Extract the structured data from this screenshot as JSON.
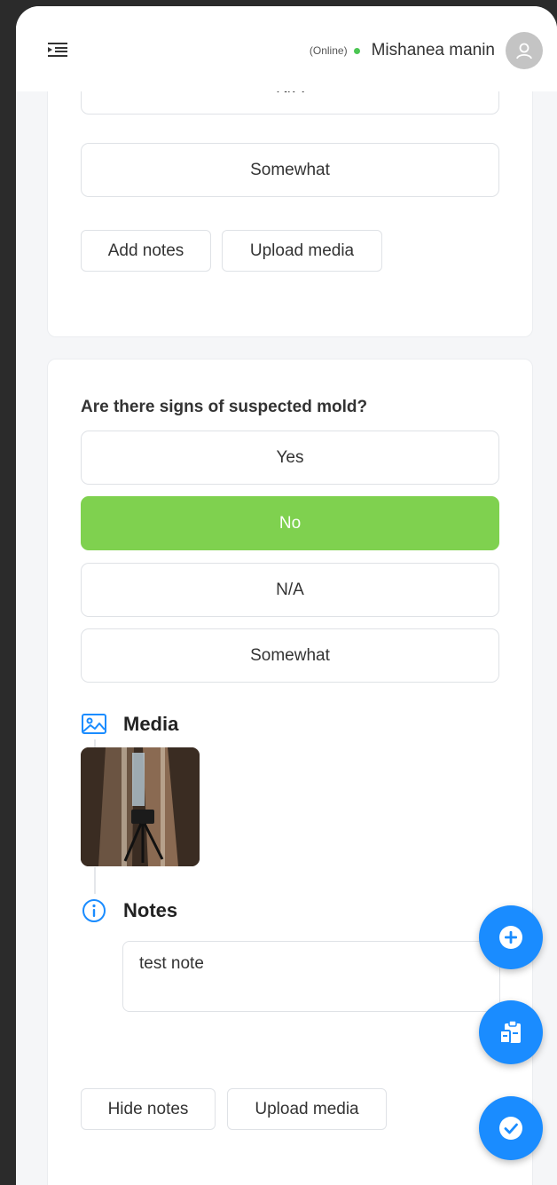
{
  "header": {
    "status": "(Online)",
    "user_name": "Mishanea manin"
  },
  "card1": {
    "options": [
      "N/A",
      "Somewhat"
    ],
    "add_notes_label": "Add notes",
    "upload_media_label": "Upload media"
  },
  "card2": {
    "question": "Are there signs of suspected mold?",
    "options": [
      "Yes",
      "No",
      "N/A",
      "Somewhat"
    ],
    "selected_option": "No",
    "media_title": "Media",
    "notes_title": "Notes",
    "note_value": "test note",
    "hide_notes_label": "Hide notes",
    "upload_media_label": "Upload media"
  },
  "colors": {
    "selected": "#7fd14f",
    "fab": "#1a8cff",
    "online": "#4cc653",
    "accent_icon": "#1a8cff"
  },
  "fabs": {
    "icons": [
      "plus-circle-icon",
      "clipboard-icon",
      "check-circle-icon"
    ]
  }
}
